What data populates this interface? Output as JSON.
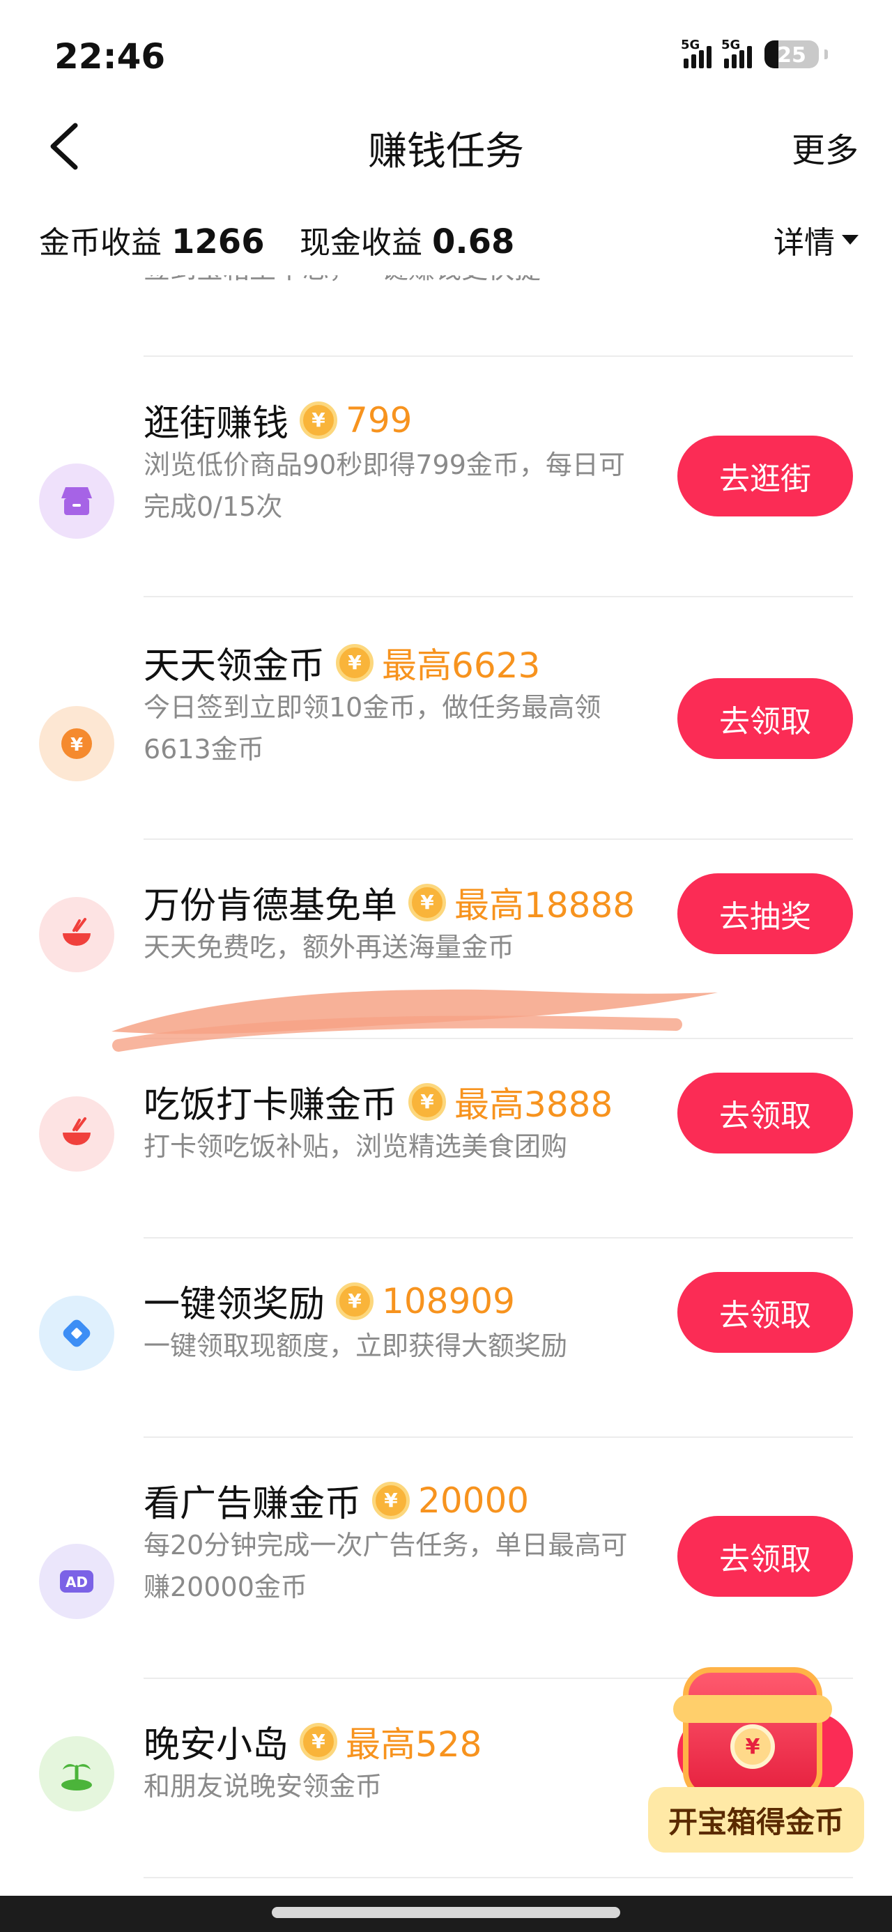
{
  "status_bar": {
    "time": "22:46",
    "signal1": "5G",
    "signal2": "5G",
    "battery": "25"
  },
  "nav": {
    "title": "赚钱任务",
    "more": "更多"
  },
  "earnings": {
    "coin_label": "金币收益",
    "coin_value": "1266",
    "cash_label": "现金收益",
    "cash_value": "0.68",
    "details": "详情"
  },
  "partial_task": {
    "desc": "签到宝箱至不忘，一键赚钱更快捷"
  },
  "tasks": [
    {
      "title": "逛街赚钱",
      "reward": "799",
      "desc": "浏览低价商品90秒即得799金币，每日可完成0/15次",
      "button": "去逛街",
      "icon": "shop-icon",
      "icon_bg": "#efe1fb",
      "icon_color": "#a663e6"
    },
    {
      "title": "天天领金币",
      "reward": "最高6623",
      "desc": "今日签到立即领10金币，做任务最高领6613金币",
      "button": "去领取",
      "icon": "yuan-coin-icon",
      "icon_bg": "#fde7d3",
      "icon_color": "#f58a2e"
    },
    {
      "title": "万份肯德基免单",
      "reward": "最高18888",
      "desc": "天天免费吃，额外再送海量金币",
      "button": "去抽奖",
      "icon": "bowl-icon",
      "icon_bg": "#fde3e3",
      "icon_color": "#f0403c"
    },
    {
      "title": "吃饭打卡赚金币",
      "reward": "最高3888",
      "desc": "打卡领吃饭补贴，浏览精选美食团购",
      "button": "去领取",
      "icon": "bowl-icon",
      "icon_bg": "#fde3e3",
      "icon_color": "#f0403c"
    },
    {
      "title": "一键领奖励",
      "reward": "108909",
      "desc": "一键领取现额度，立即获得大额奖励",
      "button": "去领取",
      "icon": "diamond-icon",
      "icon_bg": "#dff0fd",
      "icon_color": "#3d8ef5"
    },
    {
      "title": "看广告赚金币",
      "reward": "20000",
      "desc": "每20分钟完成一次广告任务，单日最高可赚20000金币",
      "button": "去领取",
      "icon": "ad-icon",
      "icon_bg": "#ebe6fb",
      "icon_color": "#7b62e6"
    },
    {
      "title": "晚安小岛",
      "reward": "最高528",
      "desc": "和朋友说晚安领金币",
      "button": "去领取",
      "icon": "island-icon",
      "icon_bg": "#e5f6dd",
      "icon_color": "#4bb43a"
    }
  ],
  "chest": {
    "label": "开宝箱得金币",
    "badge": "¥"
  },
  "coin_symbol": "¥",
  "colors": {
    "accent": "#fb2c55",
    "reward": "#f7931e",
    "coin": "#f9b43a"
  }
}
